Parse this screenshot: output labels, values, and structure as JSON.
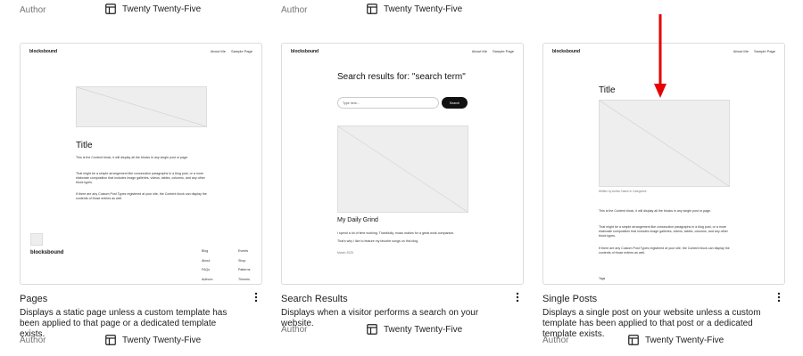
{
  "top_row": {
    "columns": [
      {
        "author_label": "Author",
        "theme_name": "Twenty Twenty-Five"
      },
      {
        "author_label": "Author",
        "theme_name": "Twenty Twenty-Five"
      }
    ]
  },
  "templates": [
    {
      "title": "Pages",
      "description": "Displays a static page unless a custom template has been applied to that page or a dedicated template exists.",
      "author_label": "Author",
      "theme_name": "Twenty Twenty-Five",
      "preview": {
        "brand": "blocksbound",
        "nav": [
          "About Me",
          "Sample Page"
        ],
        "heading": "Title",
        "paragraphs": [
          "This is the Content block, it will display all the blocks in any single post or page.",
          "That might be a simple arrangement like consecutive paragraphs in a blog post, or a more elaborate composition that includes image galleries, videos, tables, columns, and any other block types.",
          "If there are any Custom Post Types registered at your site, the Content block can display the contents of those entries as well."
        ],
        "footer_brand": "blocksbound",
        "footer_col1": [
          "Blog",
          "About",
          "FAQs",
          "Authors"
        ],
        "footer_col2": [
          "Events",
          "Shop",
          "Patterns",
          "Themes"
        ]
      }
    },
    {
      "title": "Search Results",
      "description": "Displays when a visitor performs a search on your website.",
      "author_label": "Author",
      "theme_name": "Twenty Twenty-Five",
      "preview": {
        "brand": "blocksbound",
        "nav": [
          "About Me",
          "Sample Page"
        ],
        "heading": "Search results for: \"search term\"",
        "search_placeholder": "Type here...",
        "search_button": "Search",
        "post_title": "My Daily Grind",
        "post_lines": [
          "I spend a lot of time working. Thankfully, music makes for a great work companion.",
          "That's why I like to feature my favorite songs on this blog."
        ],
        "post_date": "March 2025"
      }
    },
    {
      "title": "Single Posts",
      "description": "Displays a single post on your website unless a custom template has been applied to that post or a dedicated template exists.",
      "author_label": "Author",
      "theme_name": "Twenty Twenty-Five",
      "preview": {
        "brand": "blocksbound",
        "nav": [
          "About Me",
          "Sample Page"
        ],
        "heading": "Title",
        "byline": "Written by Author Name in Categories",
        "paragraphs": [
          "This is the Content block, it will display all the blocks in any single post or page.",
          "That might be a simple arrangement like consecutive paragraphs in a blog post, or a more elaborate composition that includes image galleries, videos, tables, columns, and any other block types.",
          "If there are any Custom Post Types registered at your site, the Content block can display the contents of those entries as well."
        ],
        "tags_label": "Tags"
      }
    }
  ],
  "colors": {
    "annotation_arrow": "#e60000",
    "meta_text": "#757575"
  }
}
